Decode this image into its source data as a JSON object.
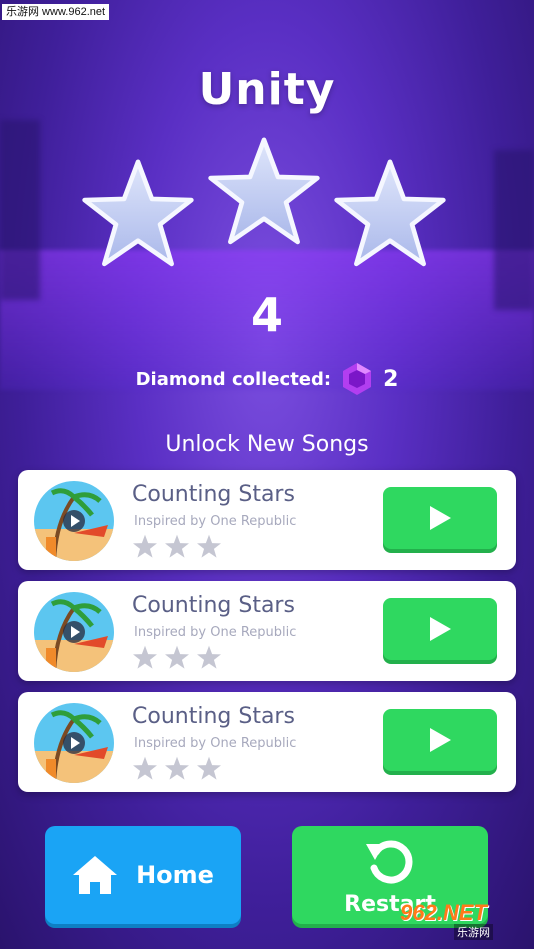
{
  "watermark_top": "乐游网 www.962.net",
  "level": {
    "title": "Unity",
    "stars_earned": 3,
    "stars_total": 3,
    "score": "4",
    "diamond_label": "Diamond collected:",
    "diamond_count": "2"
  },
  "unlock": {
    "heading": "Unlock New Songs",
    "songs": [
      {
        "title": "Counting Stars",
        "subtitle": "Inspired by One Republic",
        "stars": 0,
        "icon": "play-icon"
      },
      {
        "title": "Counting Stars",
        "subtitle": "Inspired by One Republic",
        "stars": 0,
        "icon": "play-icon"
      },
      {
        "title": "Counting Stars",
        "subtitle": "Inspired by One Republic",
        "stars": 0,
        "icon": "play-icon"
      }
    ]
  },
  "buttons": {
    "home_label": "Home",
    "restart_label": "Restart"
  },
  "watermark_bottom": {
    "main": "962.NET",
    "sub": "乐游网"
  },
  "colors": {
    "play_green": "#2fd860",
    "home_blue": "#1aa4f5",
    "diamond_purple": "#b23ef0"
  }
}
